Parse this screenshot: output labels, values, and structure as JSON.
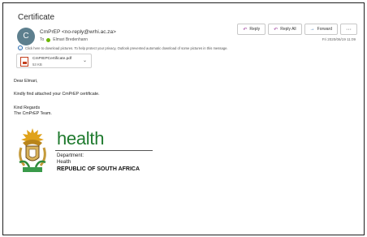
{
  "email": {
    "subject": "Certificate",
    "avatar_letter": "C",
    "sender_name": "CmPrEP",
    "sender_email": "<no-reply@wrhi.ac.za>",
    "to_label": "To",
    "recipient": "Elmari Bredenhann",
    "date": "Fri 2020/06/19 11:09",
    "info_bar": "Click here to download pictures. To help protect your privacy, Outlook prevented automatic download of some pictures in this message."
  },
  "actions": {
    "reply": "Reply",
    "reply_all": "Reply All",
    "forward": "Forward",
    "more": "···"
  },
  "attachment": {
    "filename": "CmPrEPCertificate.pdf",
    "size": "53 KB"
  },
  "body": {
    "greeting": "Dear Elmari,",
    "message": "Kindly find attached your CmPrEP certificate.",
    "signoff": "Kind Regards",
    "signature": "The CmPrEP Team."
  },
  "logo": {
    "health": "health",
    "department": "Department:",
    "ministry": "Health",
    "country": "REPUBLIC OF SOUTH AFRICA"
  }
}
